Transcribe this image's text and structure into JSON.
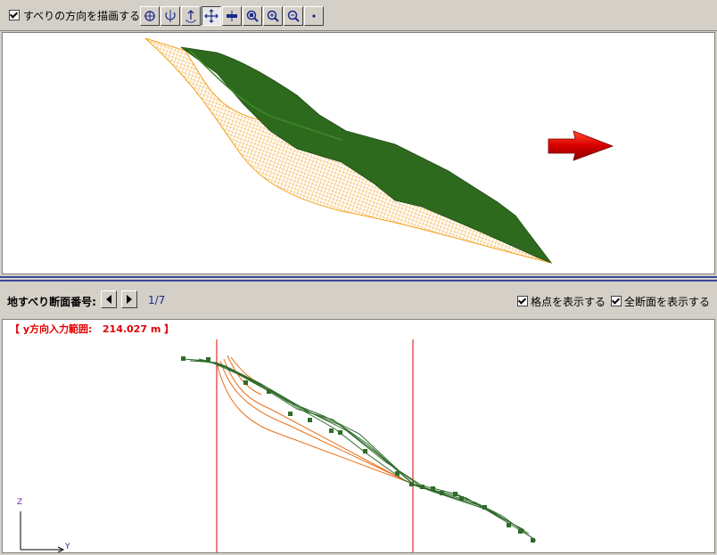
{
  "toolbar": {
    "slip_direction_label": "すべりの方向を描画する",
    "slip_direction_checked": true,
    "buttons": [
      {
        "name": "rotate-x-button",
        "icon": "rotate-x-icon"
      },
      {
        "name": "rotate-y-button",
        "icon": "rotate-y-icon"
      },
      {
        "name": "rotate-z-button",
        "icon": "rotate-z-icon"
      },
      {
        "name": "pan-button",
        "icon": "move-icon",
        "pressed": true
      },
      {
        "name": "vertical-scale-button",
        "icon": "vertical-scale-icon"
      },
      {
        "name": "zoom-window-button",
        "icon": "zoom-window-icon"
      },
      {
        "name": "zoom-in-button",
        "icon": "zoom-in-icon"
      },
      {
        "name": "zoom-out-button",
        "icon": "zoom-out-icon"
      },
      {
        "name": "point-button",
        "icon": "point-icon"
      }
    ]
  },
  "section": {
    "label": "地すべり断面番号:",
    "counter": "1/7",
    "show_grid_points_label": "格点を表示する",
    "show_grid_points_checked": true,
    "show_all_sections_label": "全断面を表示する",
    "show_all_sections_checked": true,
    "range_label": "【 y方向入力範囲:   214.027 m 】"
  },
  "axes": {
    "z": "Z",
    "y": "Y"
  },
  "colors": {
    "terrain_green": "#2e6a1e",
    "slip_orange": "#f5a018",
    "arrow_red": "#d80000",
    "range_line_red": "#e00000",
    "profile_green": "#2f6b2a",
    "slip_curve_orange": "#e8701a"
  }
}
